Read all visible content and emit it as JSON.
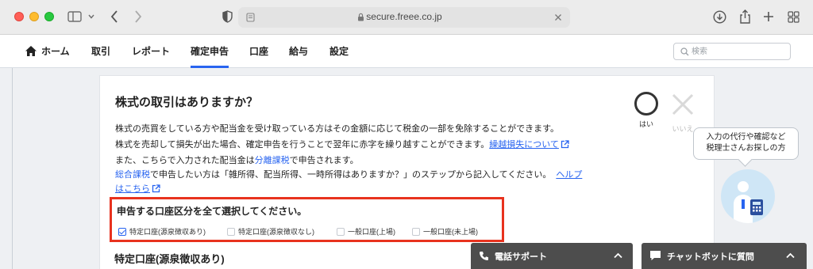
{
  "browser": {
    "url": "secure.freee.co.jp"
  },
  "nav": {
    "items": [
      {
        "label": "ホーム"
      },
      {
        "label": "取引"
      },
      {
        "label": "レポート"
      },
      {
        "label": "確定申告"
      },
      {
        "label": "口座"
      },
      {
        "label": "給与"
      },
      {
        "label": "設定"
      }
    ],
    "active": "確定申告",
    "search_placeholder": "検索"
  },
  "question": {
    "title": "株式の取引はありますか？",
    "line1": "株式の売買をしている方や配当金を受け取っている方はその金額に応じて税金の一部を免除することができます。",
    "line2_text": "株式を売却して損失が出た場合、確定申告を行うことで翌年に赤字を繰り越すことができます。",
    "line2_link": "繰越損失について",
    "line3_a": "また、こちらで入力された配当金は",
    "line3_link": "分離課税",
    "line3_b": "で申告されます。",
    "line4_link": "総合課税",
    "line4_text": "で申告したい方は「雑所得、配当所得、一時所得はありますか？」のステップから記入してください。",
    "line4_link2a": "ヘルプ",
    "line5_link": "はこちら",
    "yes_label": "はい",
    "no_label": "いいえ"
  },
  "selection": {
    "title": "申告する口座区分を全て選択してください。",
    "options": [
      {
        "label": "特定口座(源泉徴収あり)",
        "checked": true
      },
      {
        "label": "特定口座(源泉徴収なし)",
        "checked": false
      },
      {
        "label": "一般口座(上場)",
        "checked": false
      },
      {
        "label": "一般口座(未上場)",
        "checked": false
      }
    ]
  },
  "section": {
    "title": "特定口座(源泉徴収あり)"
  },
  "advisor": {
    "line1": "入力の代行や確認など",
    "line2": "税理士さんお探しの方"
  },
  "panels": {
    "phone": "電話サポート",
    "chat": "チャットボットに質問"
  },
  "colors": {
    "accent": "#2864f0",
    "highlight_border": "#e8321e",
    "panel_bg": "#4d4d4d"
  }
}
